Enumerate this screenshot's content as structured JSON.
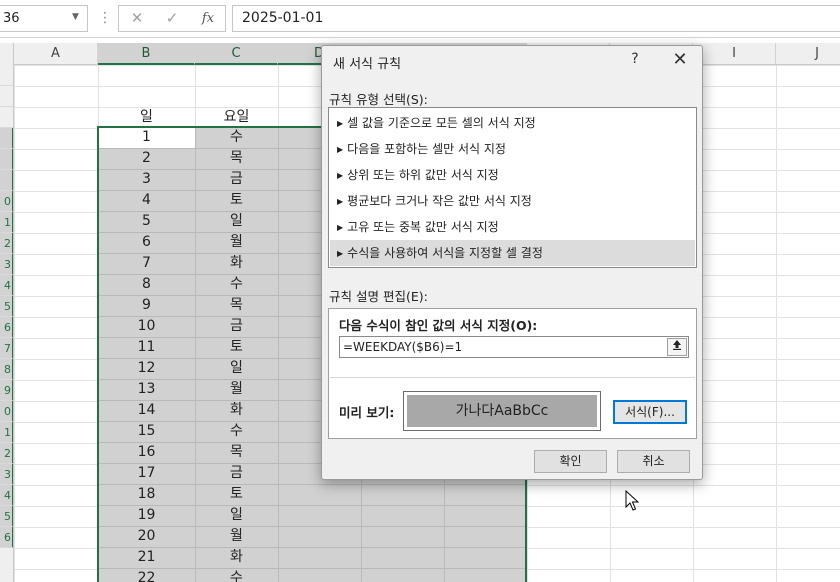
{
  "formula_bar": {
    "name_box": "36",
    "formula": "2025-01-01",
    "dots_icon": "⋮",
    "cancel_icon": "✕",
    "confirm_icon": "✓",
    "fx_label": "fx"
  },
  "grid": {
    "columns": [
      "A",
      "B",
      "C",
      "D",
      "",
      "",
      "I",
      "J"
    ],
    "row_numbers": [
      "",
      "",
      "",
      "",
      "",
      "",
      "0",
      "1",
      "2",
      "3",
      "4",
      "5",
      "6",
      "7",
      "8",
      "9",
      "0",
      "1",
      "2",
      "3",
      "4",
      "5",
      "6"
    ],
    "header_day": "일",
    "header_weekday": "요일",
    "days": [
      "1",
      "2",
      "3",
      "4",
      "5",
      "6",
      "7",
      "8",
      "9",
      "10",
      "11",
      "12",
      "13",
      "14",
      "15",
      "16",
      "17",
      "18",
      "19",
      "20",
      "21",
      "22"
    ],
    "weekdays": [
      "수",
      "목",
      "금",
      "토",
      "일",
      "월",
      "화",
      "수",
      "목",
      "금",
      "토",
      "일",
      "월",
      "화",
      "수",
      "목",
      "금",
      "토",
      "일",
      "월",
      "화",
      "수"
    ]
  },
  "dialog": {
    "title": "새 서식 규칙",
    "help": "?",
    "close": "✕",
    "rule_type_label": "규칙 유형 선택(S):",
    "rule_types": [
      "셀 값을 기준으로 모든 셀의 서식 지정",
      "다음을 포함하는 셀만 서식 지정",
      "상위 또는 하위 값만 서식 지정",
      "평균보다 크거나 작은 값만 서식 지정",
      "고유 또는 중복 값만 서식 지정",
      "수식을 사용하여 서식을 지정할 셀 결정"
    ],
    "selected_rule_index": 5,
    "edit_label": "규칙 설명 편집(E):",
    "formula_caption": "다음 수식이 참인 값의 서식 지정(O):",
    "formula_value": "=WEEKDAY($B6)=1",
    "preview_label": "미리 보기:",
    "preview_text": "가나다AaBbCc",
    "format_button": "서식(F)...",
    "ok_button": "확인",
    "cancel_button": "취소"
  }
}
